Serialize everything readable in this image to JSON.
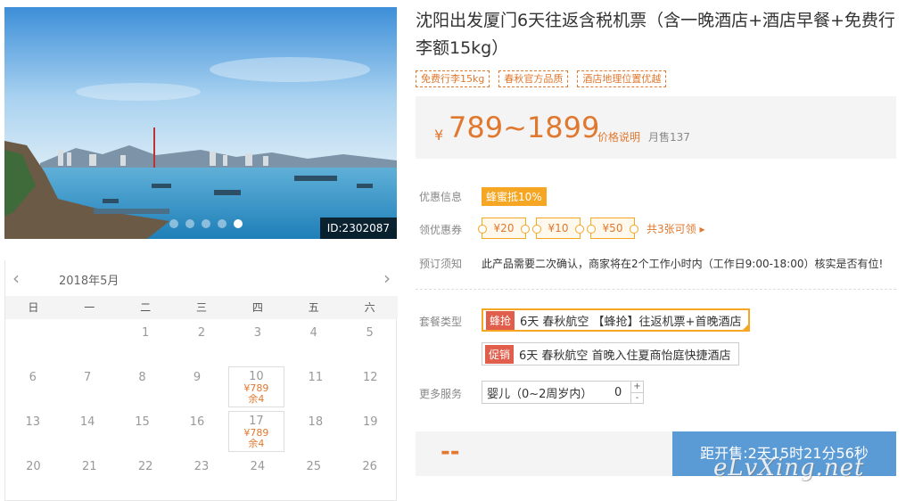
{
  "product": {
    "title": "沈阳出发厦门6天往返含税机票（含一晚酒店+酒店早餐+免费行李额15kg）",
    "tags": [
      "免费行李15kg",
      "春秋官方品质",
      "酒店地理位置优越"
    ],
    "photo_id": "ID:2302087",
    "slide_count": 5,
    "active_slide": 5
  },
  "price": {
    "currency": "¥",
    "range": "789~1899",
    "explain_label": "价格说明",
    "sold": "月售137"
  },
  "calendar": {
    "month": "2018年5月",
    "prev": "‹",
    "next": "›",
    "weekdays": [
      "日",
      "一",
      "二",
      "三",
      "四",
      "五",
      "六"
    ],
    "weeks": [
      [
        {
          "d": ""
        },
        {
          "d": ""
        },
        {
          "d": "1"
        },
        {
          "d": "2"
        },
        {
          "d": "3"
        },
        {
          "d": "4"
        },
        {
          "d": "5"
        }
      ],
      [
        {
          "d": "6"
        },
        {
          "d": "7"
        },
        {
          "d": "8"
        },
        {
          "d": "9"
        },
        {
          "d": "10",
          "price": "¥789",
          "left": "余4"
        },
        {
          "d": "11"
        },
        {
          "d": "12"
        }
      ],
      [
        {
          "d": "13"
        },
        {
          "d": "14"
        },
        {
          "d": "15"
        },
        {
          "d": "16"
        },
        {
          "d": "17",
          "price": "¥789",
          "left": "余4"
        },
        {
          "d": "18"
        },
        {
          "d": "19"
        }
      ],
      [
        {
          "d": "20"
        },
        {
          "d": "21"
        },
        {
          "d": "22"
        },
        {
          "d": "23"
        },
        {
          "d": "24"
        },
        {
          "d": "25"
        },
        {
          "d": "26"
        }
      ]
    ]
  },
  "offers": {
    "promo_label": "优惠信息",
    "promo_badge": "蜂蜜抵10%",
    "coupon_label": "领优惠券",
    "coupons": [
      "¥20",
      "¥10",
      "¥50"
    ],
    "coupon_more": "共3张可领 ▸",
    "notice_label": "预订须知",
    "notice_text": "此产品需要二次确认，商家将在2个工作小时内（工作日9:00-18:00）核实是否有位!"
  },
  "packages": {
    "label": "套餐类型",
    "items": [
      {
        "badge": "蜂抢",
        "text": "6天 春秋航空 【蜂抢】往返机票+首晚酒店",
        "selected": true
      },
      {
        "badge": "促销",
        "text": "6天 春秋航空 首晚入住夏商怡庭快捷酒店",
        "selected": false
      }
    ]
  },
  "services": {
    "label": "更多服务",
    "item": "婴儿（0~2周岁内）",
    "count": "0",
    "plus": "+",
    "minus": "-"
  },
  "purchase": {
    "total": "--",
    "countdown": "距开售:2天15时21分56秒"
  },
  "watermark": "eLvXing.net",
  "colors": {
    "accent_orange": "#e0782f",
    "badge_yellow": "#f5a623",
    "badge_red": "#e05e4b",
    "buy_blue": "#5b9bd5"
  }
}
